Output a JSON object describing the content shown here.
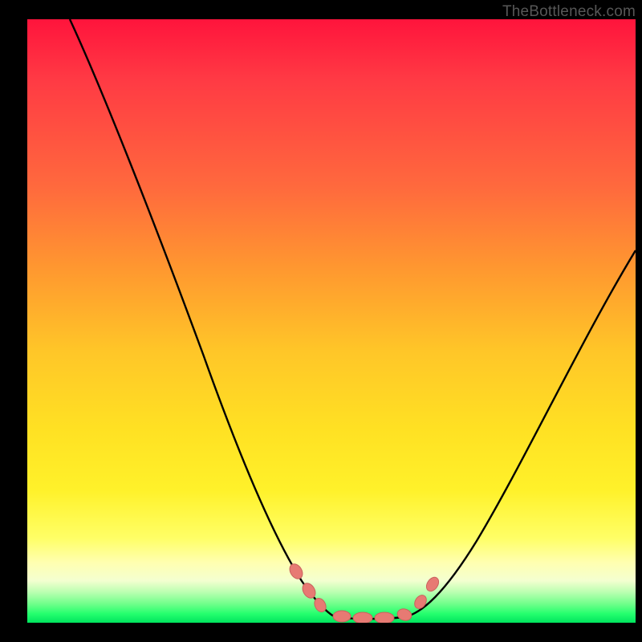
{
  "attribution": "TheBottleneck.com",
  "colors": {
    "frame_border": "#000000",
    "curve_stroke": "#000000",
    "marker_fill": "#e77a73",
    "marker_stroke": "#c75a55",
    "gradient_stops": [
      "#ff143c",
      "#ff6a3d",
      "#ffc628",
      "#ffff66",
      "#f4ffd0",
      "#25ff6e",
      "#00e45e"
    ]
  },
  "chart_data": {
    "type": "line",
    "title": "",
    "xlabel": "",
    "ylabel": "",
    "xlim": [
      0,
      100
    ],
    "ylim": [
      0,
      100
    ],
    "notes": "V-shaped bottleneck curve; y is mismatch percentage (higher=worse). Left branch descends steeply from top-left, flat optimum near x≈50-60, right branch rises toward upper-right. Markers highlight near-optimum region.",
    "series": [
      {
        "name": "left-branch",
        "x": [
          7,
          10,
          14,
          18,
          22,
          26,
          30,
          34,
          38,
          41,
          44,
          46,
          48
        ],
        "y": [
          100,
          91,
          80,
          69,
          58,
          48,
          38,
          29,
          21,
          14,
          9,
          5,
          2
        ]
      },
      {
        "name": "optimum-flat",
        "x": [
          48,
          50,
          52,
          54,
          56,
          58,
          60,
          62
        ],
        "y": [
          2,
          1,
          0.5,
          0.3,
          0.3,
          0.5,
          1,
          2
        ]
      },
      {
        "name": "right-branch",
        "x": [
          62,
          66,
          70,
          74,
          78,
          82,
          86,
          90,
          94,
          98,
          100
        ],
        "y": [
          2,
          5,
          9,
          14,
          20,
          27,
          34,
          42,
          50,
          58,
          62
        ]
      }
    ],
    "markers": {
      "name": "highlighted-points",
      "x": [
        44.5,
        46.5,
        48,
        51,
        54,
        57,
        60,
        62.5,
        64.5
      ],
      "y": [
        8,
        4.5,
        2.5,
        1,
        0.5,
        0.6,
        1.3,
        3,
        6
      ]
    }
  }
}
